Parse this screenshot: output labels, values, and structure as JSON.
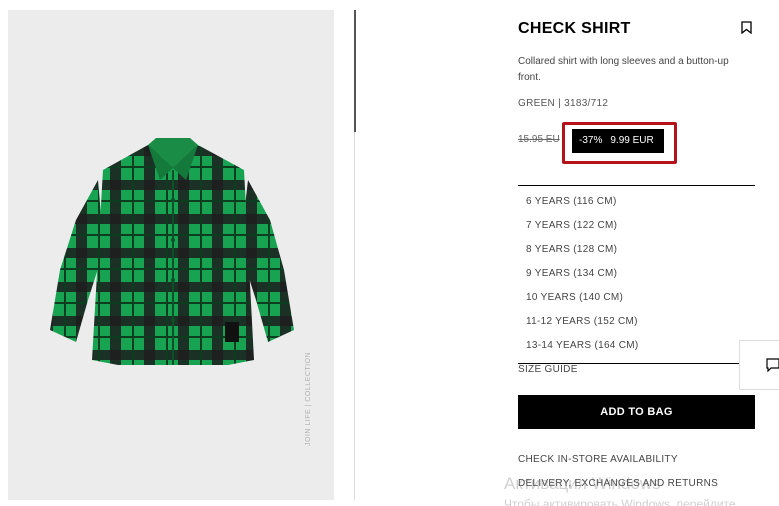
{
  "product": {
    "title": "CHECK SHIRT",
    "description": "Collared shirt with long sleeves and a button-up front.",
    "color_ref": "GREEN | 3183/712",
    "image_caption": "JOIN LIFE | COLLECTION",
    "old_price": "15.95 EU",
    "discount": "-37%",
    "new_price": "9.99 EUR"
  },
  "sizes": [
    "6 YEARS (116 CM)",
    "7 YEARS (122 CM)",
    "8 YEARS (128 CM)",
    "9 YEARS (134 CM)",
    "10 YEARS (140 CM)",
    "11-12 YEARS (152 CM)",
    "13-14 YEARS (164 CM)"
  ],
  "actions": {
    "size_guide": "SIZE GUIDE",
    "add_to_bag": "ADD TO BAG",
    "check_store": "CHECK IN-STORE AVAILABILITY",
    "delivery": "DELIVERY, EXCHANGES AND RETURNS"
  },
  "os_watermark": {
    "line1": "Активация Windows",
    "line2": "Чтобы активировать Windows, перейдите"
  },
  "icons": {
    "bookmark": "bookmark-icon",
    "chat": "chat-icon"
  },
  "colors": {
    "highlight_border": "#b5121b",
    "shirt_green": "#15a050",
    "shirt_dark": "#1c1c1c"
  }
}
